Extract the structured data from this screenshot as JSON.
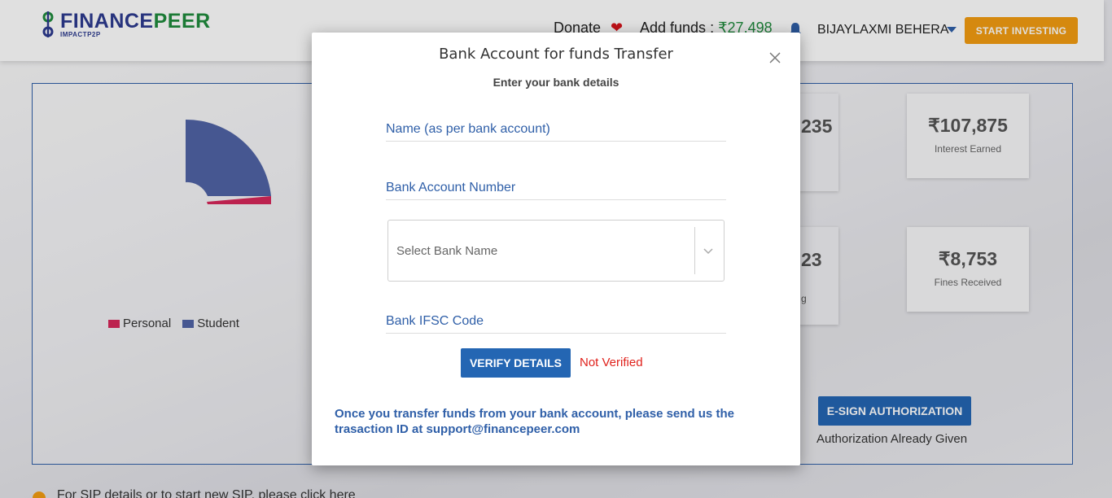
{
  "header": {
    "logo_main_a": "FINANCE",
    "logo_main_b": "PEER",
    "logo_sub": "IMPACTP2P",
    "donate_label": "Donate",
    "add_funds_label": "Add funds :",
    "add_funds_amount": "₹27,498",
    "user_name": "BIJAYLAXMI BEHERA",
    "start_investing": "START INVESTING"
  },
  "dashboard": {
    "legend": [
      {
        "label": "Personal",
        "color": "#d6275a"
      },
      {
        "label": "Student",
        "color": "#5063a6"
      }
    ],
    "partial_values": [
      "235",
      "23",
      "g"
    ],
    "cards": [
      {
        "value": "₹107,875",
        "label": "Interest Earned"
      },
      {
        "value": "₹8,753",
        "label": "Fines Received"
      }
    ],
    "esign_button": "E-SIGN AUTHORIZATION",
    "auth_status": "Authorization Already Given",
    "sip_text": "For SIP details or to start new SIP, please click here"
  },
  "modal": {
    "title": "Bank Account for funds Transfer",
    "subtitle": "Enter your bank details",
    "name_placeholder": "Name (as per bank account)",
    "account_placeholder": "Bank Account Number",
    "bank_select_placeholder": "Select Bank Name",
    "ifsc_placeholder": "Bank IFSC Code",
    "verify_button": "VERIFY DETAILS",
    "verify_status": "Not Verified",
    "note": "Once you transfer funds from your bank account, please send us the trasaction ID at support@financepeer.com"
  },
  "colors": {
    "brand_blue": "#2d3b8f",
    "brand_green": "#1f8b3d",
    "accent_orange": "#f39c12",
    "button_blue": "#2466b3",
    "error_red": "#e0211b"
  }
}
